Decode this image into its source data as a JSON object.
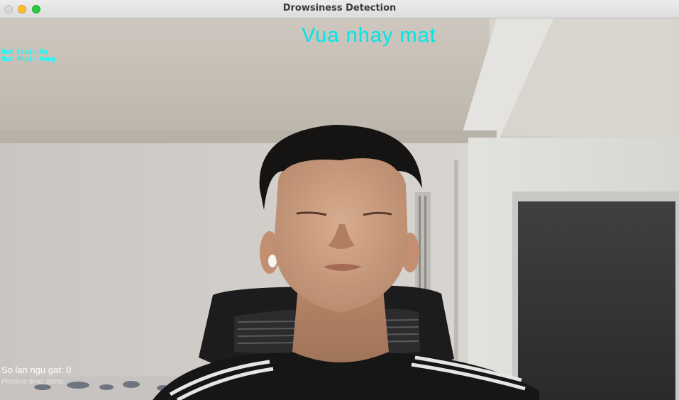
{
  "window": {
    "title": "Drowsiness Detection"
  },
  "overlay": {
    "status": "Vua nhay mat",
    "left_eye": "Mat Trai: Mo",
    "right_eye": "Mat Phai: Dong",
    "sleep_count": "So lan ngu gat: 0",
    "process_time": "Process time: 80ms"
  },
  "colors": {
    "status_text": "#00e5e5",
    "eye_text": "#00ffff",
    "close_button": "#d8d8d8",
    "minimize_button": "#febc2e",
    "maximize_button": "#28c840"
  },
  "icons": [
    "close-button",
    "minimize-button",
    "maximize-button"
  ]
}
